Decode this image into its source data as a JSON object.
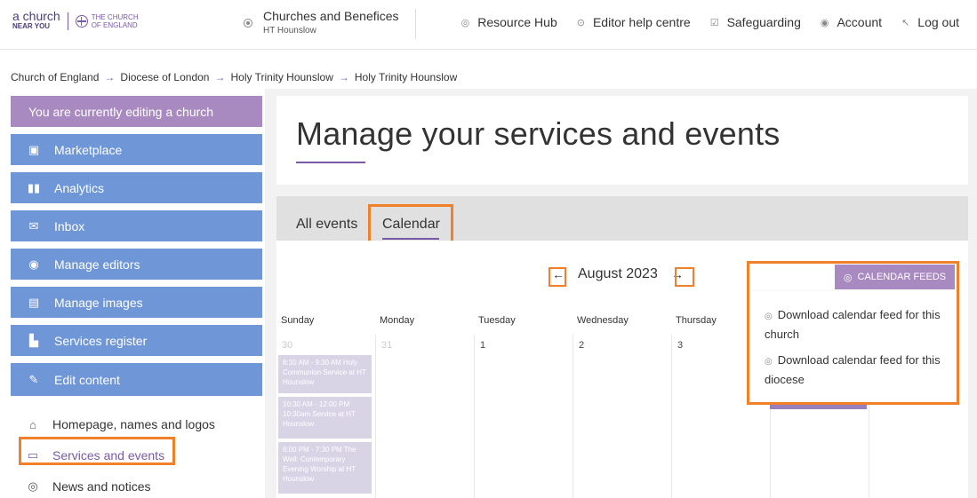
{
  "header": {
    "logo": {
      "line1": "a church",
      "line2": "NEAR YOU",
      "coe_line1": "THE CHURCH",
      "coe_line2": "OF ENGLAND"
    },
    "church_selector": {
      "title": "Churches and Benefices",
      "subtitle": "HT Hounslow"
    },
    "nav": [
      {
        "label": "Resource Hub",
        "icon": "feed-icon"
      },
      {
        "label": "Editor help centre",
        "icon": "help-icon"
      },
      {
        "label": "Safeguarding",
        "icon": "check-square-icon"
      },
      {
        "label": "Account",
        "icon": "user-icon"
      },
      {
        "label": "Log out",
        "icon": "logout-icon"
      }
    ]
  },
  "breadcrumb": [
    "Church of England",
    "Diocese of London",
    "Holy Trinity Hounslow",
    "Holy Trinity Hounslow"
  ],
  "sidebar": {
    "editing_label": "You are currently editing a church",
    "buttons": [
      {
        "label": "Marketplace",
        "icon": "basket-icon"
      },
      {
        "label": "Analytics",
        "icon": "bar-chart-icon"
      },
      {
        "label": "Inbox",
        "icon": "envelope-icon"
      },
      {
        "label": "Manage editors",
        "icon": "user-circle-icon"
      },
      {
        "label": "Manage images",
        "icon": "image-icon"
      },
      {
        "label": "Services register",
        "icon": "document-icon"
      },
      {
        "label": "Edit content",
        "icon": "pencil-icon"
      }
    ],
    "subitems": [
      {
        "label": "Homepage, names and logos",
        "icon": "home-icon"
      },
      {
        "label": "Services and events",
        "icon": "calendar-icon"
      },
      {
        "label": "News and notices",
        "icon": "feed-icon"
      }
    ]
  },
  "main": {
    "title": "Manage your services and events",
    "tabs": [
      "All events",
      "Calendar"
    ],
    "calendar": {
      "month": "August 2023",
      "feeds_label": "CALENDAR FEEDS",
      "feed_options": [
        "Download calendar feed for this church",
        "Download calendar feed for this diocese"
      ],
      "days": [
        "Sunday",
        "Monday",
        "Tuesday",
        "Wednesday",
        "Thursday"
      ],
      "dates": [
        "30",
        "31",
        "1",
        "2",
        "3"
      ],
      "events": [
        "8:30 AM - 9:30 AM Holy Communion Service at HT Hounslow",
        "10:30 AM - 12:00 PM 10:30am Service at HT Hounslow",
        "6:00 PM - 7:30 PM The Well: Contemporary Evening Worship at HT Hounslow"
      ]
    }
  },
  "colors": {
    "accent_purple": "#7a5aa6",
    "light_purple": "#a88ac0",
    "blue": "#6f96d6",
    "highlight_orange": "#f0802a"
  }
}
